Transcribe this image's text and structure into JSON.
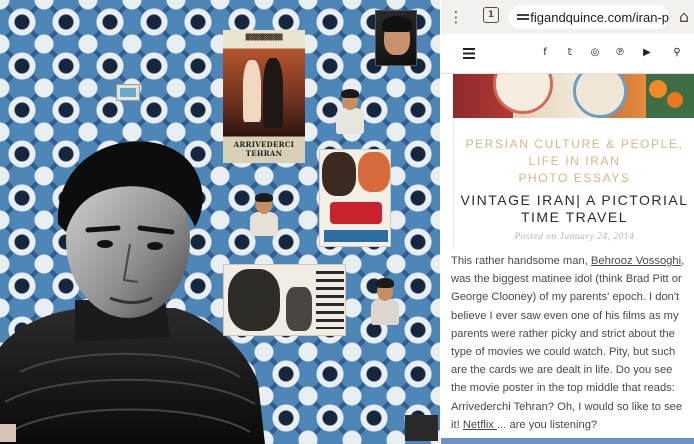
{
  "browser": {
    "url": "figandquince.com/iran-p",
    "tab_count": "1"
  },
  "site_nav": {
    "social_icons": [
      "facebook-icon",
      "twitter-icon",
      "instagram-icon",
      "pinterest-icon",
      "youtube-icon",
      "search-icon"
    ],
    "social_glyphs": [
      "f",
      "𝕥",
      "◎",
      "℗",
      "▶",
      "⚲"
    ]
  },
  "post": {
    "categories": [
      "PERSIAN CULTURE & PEOPLE,",
      "LIFE IN IRAN",
      "PHOTO ESSAYS"
    ],
    "title_line1": "VINTAGE IRAN| A PICTORIAL",
    "title_line2": "TIME TRAVEL",
    "date": "Posted on January 24, 2014",
    "body": {
      "part1": "This rather handsome man, ",
      "link1": "Behrooz Vossoghi",
      "part2": ", was the biggest matinee idol (think Brad Pitt or George Clooney) of my parents' epoch. I don't believe I ever saw even one of his films as my parents were rather picky and strict about the type of movies we could watch. Pity, but such are the cards we are dealt in life. Do you see the movie poster in the top middle that reads: Arrivederchi Tehran? Oh, I would so like to see it! ",
      "link2": "Netflix ",
      "part3": "... are you listening?"
    }
  },
  "collage": {
    "poster_arrivederci_title": "ARRIVEDERCI TEHRAN"
  },
  "colors": {
    "category_gold": "#d7b784",
    "tile_blue": "#4f86b8",
    "tile_dark": "#16263d"
  }
}
